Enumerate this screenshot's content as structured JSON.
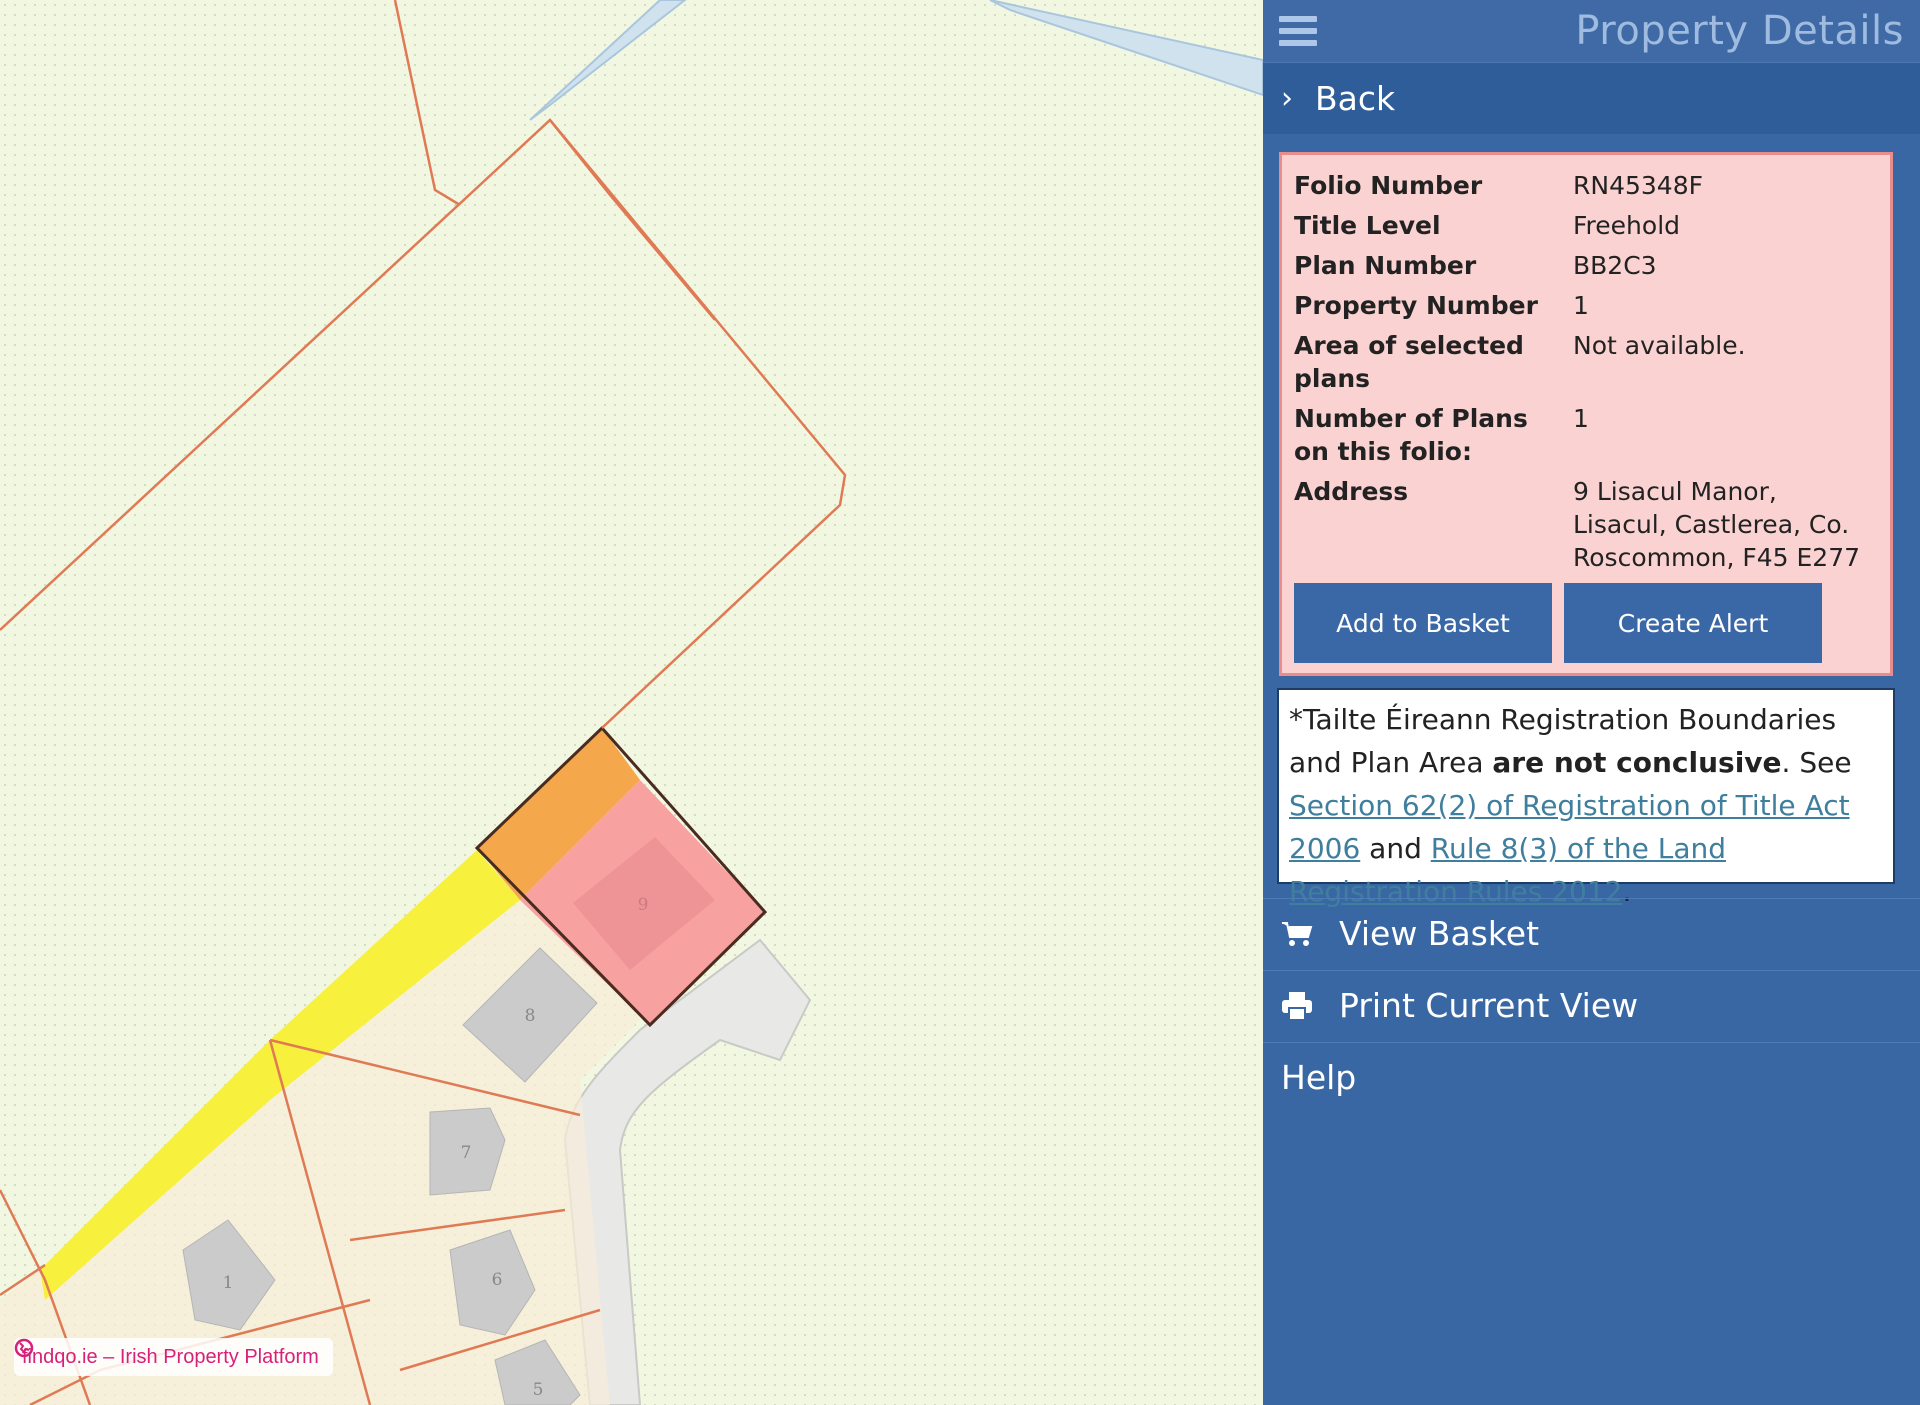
{
  "panel": {
    "title": "Property Details",
    "back_label": "Back"
  },
  "details": {
    "rows": [
      {
        "label": "Folio Number",
        "value": "RN45348F"
      },
      {
        "label": "Title Level",
        "value": "Freehold"
      },
      {
        "label": "Plan Number",
        "value": "BB2C3"
      },
      {
        "label": "Property Number",
        "value": "1"
      },
      {
        "label": "Area of selected plans",
        "value": "Not available."
      },
      {
        "label": "Number of Plans on this folio:",
        "value": "1"
      },
      {
        "label": "Address",
        "value": "9 Lisacul Manor, Lisacul, Castlerea, Co. Roscommon, F45 E277"
      }
    ],
    "add_to_basket_label": "Add to Basket",
    "create_alert_label": "Create Alert"
  },
  "disclaimer": {
    "intro": "*Tailte Éireann Registration Boundaries and Plan Area ",
    "bold": "are not conclusive",
    "see": ". See ",
    "link1": "Section 62(2) of Registration of Title Act 2006",
    "and": " and ",
    "link2": "Rule 8(3) of the Land Registration Rules 2012",
    "end": "."
  },
  "nav": {
    "view_basket": "View Basket",
    "print_view": "Print Current View",
    "help": "Help"
  },
  "map": {
    "house_numbers": [
      "9",
      "8",
      "7",
      "6",
      "1",
      "5"
    ]
  },
  "watermark": "findqo.ie – Irish Property Platform",
  "colors": {
    "panel_bg": "#3967a3",
    "details_bg": "#fbd2d2",
    "button_bg": "#3a68a6",
    "boundary_line": "#e07a55",
    "selected_parcel": "#f7a1a1",
    "highlight_yellow": "#f7f03c",
    "highlight_orange": "#f5a84b"
  }
}
